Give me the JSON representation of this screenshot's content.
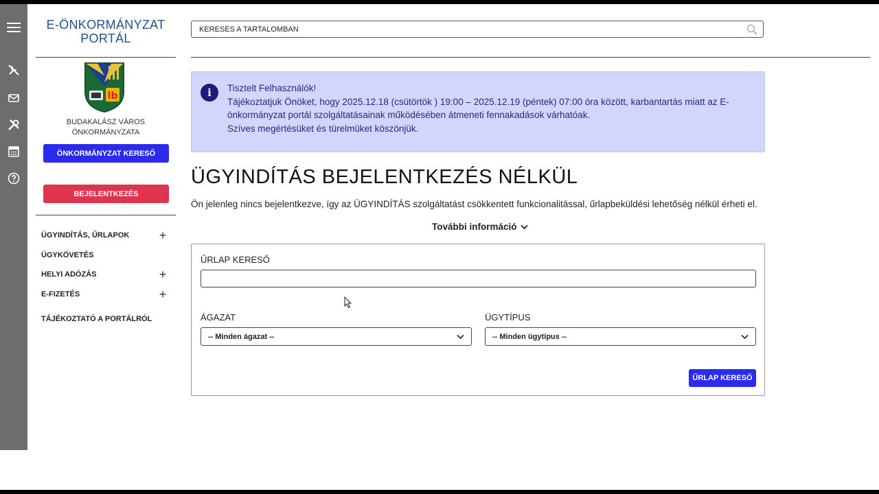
{
  "portal": {
    "title_line1": "E-ÖNKORMÁNYZAT",
    "title_line2": "PORTÁL",
    "town_line1": "BUDAKALÁSZ VÁROS",
    "town_line2": "ÖNKORMÁNYZATA"
  },
  "buttons": {
    "municipality_search": "ÖNKORMÁNYZAT KERESŐ",
    "login": "BEJELENTKEZÉS",
    "form_search": "ŰRLAP KERESŐ"
  },
  "side_rail": {
    "icons": [
      "menu-icon",
      "tools-off-icon",
      "mail-icon",
      "tools-icon",
      "calculator-icon",
      "help-icon"
    ]
  },
  "menu": {
    "items": [
      {
        "label": "ÜGYINDÍTÁS, ŰRLAPOK",
        "expand": "+"
      },
      {
        "label": "ÜGYKÖVETÉS",
        "expand": ""
      },
      {
        "label": "HELYI ADÓZÁS",
        "expand": "+"
      },
      {
        "label": "E-FIZETÉS",
        "expand": "+"
      },
      {
        "label": "TÁJÉKOZTATÓ A PORTÁLRÓL",
        "expand": ""
      }
    ]
  },
  "search": {
    "placeholder": "KERESÉS A TARTALOMBAN"
  },
  "notice": {
    "line1": "Tisztelt Felhasználók!",
    "line2": "Tájékoztatjuk Önöket, hogy 2025.12.18 (csütörtök ) 19:00 – 2025.12.19 (péntek) 07:00 óra között, karbantartás miatt az E-",
    "line3": "önkormányzat portál szolgáltatásainak működésében átmeneti fennakadások várhatóak.",
    "line4": "Szíves megértésüket és türelmüket köszönjük."
  },
  "main": {
    "heading": "ÜGYINDÍTÁS BEJELENTKEZÉS NÉLKÜL",
    "lead": "Ön jelenleg nincs bejelentkezve, így az ÜGYINDÍTÁS szolgáltatást csökkentett funkcionalitással, űrlapbeküldési lehetőség nélkül érheti el.",
    "more_info": "További információ"
  },
  "form": {
    "search_label": "ŰRLAP KERESŐ",
    "search_value": "",
    "sector_label": "ÁGAZAT",
    "sector_selected": "-- Minden ágazat --",
    "type_label": "ÜGYTÍPUS",
    "type_selected": "-- Minden ügytípus --"
  },
  "colors": {
    "primary_blue": "#2b2bee",
    "login_red": "#e0334d",
    "notice_bg": "#d3d5fb",
    "notice_text": "#232a80",
    "rail_gray": "#6d6d6d",
    "title_blue": "#1f4f8f"
  }
}
